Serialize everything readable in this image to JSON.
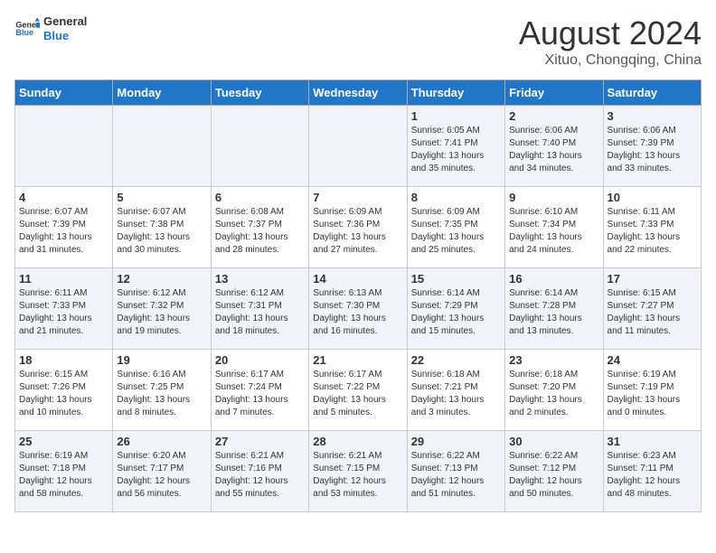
{
  "logo": {
    "line1": "General",
    "line2": "Blue"
  },
  "title": "August 2024",
  "subtitle": "Xituo, Chongqing, China",
  "days_header": [
    "Sunday",
    "Monday",
    "Tuesday",
    "Wednesday",
    "Thursday",
    "Friday",
    "Saturday"
  ],
  "weeks": [
    [
      {
        "day": "",
        "info": ""
      },
      {
        "day": "",
        "info": ""
      },
      {
        "day": "",
        "info": ""
      },
      {
        "day": "",
        "info": ""
      },
      {
        "day": "1",
        "info": "Sunrise: 6:05 AM\nSunset: 7:41 PM\nDaylight: 13 hours\nand 35 minutes."
      },
      {
        "day": "2",
        "info": "Sunrise: 6:06 AM\nSunset: 7:40 PM\nDaylight: 13 hours\nand 34 minutes."
      },
      {
        "day": "3",
        "info": "Sunrise: 6:06 AM\nSunset: 7:39 PM\nDaylight: 13 hours\nand 33 minutes."
      }
    ],
    [
      {
        "day": "4",
        "info": "Sunrise: 6:07 AM\nSunset: 7:39 PM\nDaylight: 13 hours\nand 31 minutes."
      },
      {
        "day": "5",
        "info": "Sunrise: 6:07 AM\nSunset: 7:38 PM\nDaylight: 13 hours\nand 30 minutes."
      },
      {
        "day": "6",
        "info": "Sunrise: 6:08 AM\nSunset: 7:37 PM\nDaylight: 13 hours\nand 28 minutes."
      },
      {
        "day": "7",
        "info": "Sunrise: 6:09 AM\nSunset: 7:36 PM\nDaylight: 13 hours\nand 27 minutes."
      },
      {
        "day": "8",
        "info": "Sunrise: 6:09 AM\nSunset: 7:35 PM\nDaylight: 13 hours\nand 25 minutes."
      },
      {
        "day": "9",
        "info": "Sunrise: 6:10 AM\nSunset: 7:34 PM\nDaylight: 13 hours\nand 24 minutes."
      },
      {
        "day": "10",
        "info": "Sunrise: 6:11 AM\nSunset: 7:33 PM\nDaylight: 13 hours\nand 22 minutes."
      }
    ],
    [
      {
        "day": "11",
        "info": "Sunrise: 6:11 AM\nSunset: 7:33 PM\nDaylight: 13 hours\nand 21 minutes."
      },
      {
        "day": "12",
        "info": "Sunrise: 6:12 AM\nSunset: 7:32 PM\nDaylight: 13 hours\nand 19 minutes."
      },
      {
        "day": "13",
        "info": "Sunrise: 6:12 AM\nSunset: 7:31 PM\nDaylight: 13 hours\nand 18 minutes."
      },
      {
        "day": "14",
        "info": "Sunrise: 6:13 AM\nSunset: 7:30 PM\nDaylight: 13 hours\nand 16 minutes."
      },
      {
        "day": "15",
        "info": "Sunrise: 6:14 AM\nSunset: 7:29 PM\nDaylight: 13 hours\nand 15 minutes."
      },
      {
        "day": "16",
        "info": "Sunrise: 6:14 AM\nSunset: 7:28 PM\nDaylight: 13 hours\nand 13 minutes."
      },
      {
        "day": "17",
        "info": "Sunrise: 6:15 AM\nSunset: 7:27 PM\nDaylight: 13 hours\nand 11 minutes."
      }
    ],
    [
      {
        "day": "18",
        "info": "Sunrise: 6:15 AM\nSunset: 7:26 PM\nDaylight: 13 hours\nand 10 minutes."
      },
      {
        "day": "19",
        "info": "Sunrise: 6:16 AM\nSunset: 7:25 PM\nDaylight: 13 hours\nand 8 minutes."
      },
      {
        "day": "20",
        "info": "Sunrise: 6:17 AM\nSunset: 7:24 PM\nDaylight: 13 hours\nand 7 minutes."
      },
      {
        "day": "21",
        "info": "Sunrise: 6:17 AM\nSunset: 7:22 PM\nDaylight: 13 hours\nand 5 minutes."
      },
      {
        "day": "22",
        "info": "Sunrise: 6:18 AM\nSunset: 7:21 PM\nDaylight: 13 hours\nand 3 minutes."
      },
      {
        "day": "23",
        "info": "Sunrise: 6:18 AM\nSunset: 7:20 PM\nDaylight: 13 hours\nand 2 minutes."
      },
      {
        "day": "24",
        "info": "Sunrise: 6:19 AM\nSunset: 7:19 PM\nDaylight: 13 hours\nand 0 minutes."
      }
    ],
    [
      {
        "day": "25",
        "info": "Sunrise: 6:19 AM\nSunset: 7:18 PM\nDaylight: 12 hours\nand 58 minutes."
      },
      {
        "day": "26",
        "info": "Sunrise: 6:20 AM\nSunset: 7:17 PM\nDaylight: 12 hours\nand 56 minutes."
      },
      {
        "day": "27",
        "info": "Sunrise: 6:21 AM\nSunset: 7:16 PM\nDaylight: 12 hours\nand 55 minutes."
      },
      {
        "day": "28",
        "info": "Sunrise: 6:21 AM\nSunset: 7:15 PM\nDaylight: 12 hours\nand 53 minutes."
      },
      {
        "day": "29",
        "info": "Sunrise: 6:22 AM\nSunset: 7:13 PM\nDaylight: 12 hours\nand 51 minutes."
      },
      {
        "day": "30",
        "info": "Sunrise: 6:22 AM\nSunset: 7:12 PM\nDaylight: 12 hours\nand 50 minutes."
      },
      {
        "day": "31",
        "info": "Sunrise: 6:23 AM\nSunset: 7:11 PM\nDaylight: 12 hours\nand 48 minutes."
      }
    ]
  ]
}
